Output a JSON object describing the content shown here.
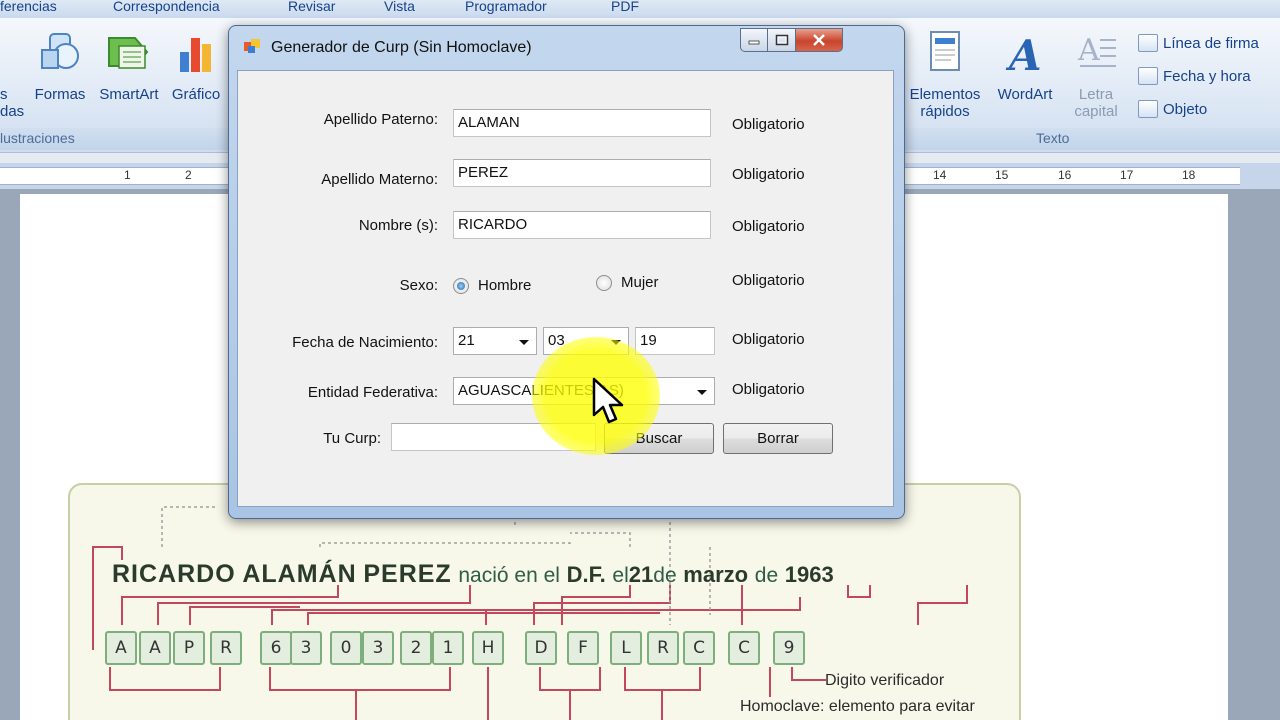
{
  "word": {
    "menu": [
      "ferencias",
      "Correspondencia",
      "Revisar",
      "Vista",
      "Programador",
      "PDF"
    ],
    "ribbon_buttons": {
      "formas": "Formas",
      "smartart": "SmartArt",
      "grafico": "Gráfico",
      "left_cut_1": "s",
      "left_cut_2": "das",
      "elementos_1": "Elementos",
      "elementos_2": "rápidos",
      "wordart": "WordArt",
      "letra_1": "Letra",
      "letra_2": "capital"
    },
    "small_buttons": [
      "Línea de firma",
      "Fecha y hora",
      "Objeto"
    ],
    "group_labels": {
      "ilustraciones": "lustraciones",
      "texto": "Texto"
    },
    "ruler_left": [
      "1",
      "2"
    ],
    "ruler_right": [
      "14",
      "15",
      "16",
      "17",
      "18"
    ]
  },
  "dialog": {
    "title": "Generador de Curp (Sin Homoclave)",
    "labels": {
      "apellido_paterno": "Apellido Paterno:",
      "apellido_materno": "Apellido Materno:",
      "nombre": "Nombre (s):",
      "sexo": "Sexo:",
      "fecha": "Fecha de Nacimiento:",
      "entidad": "Entidad Federativa:",
      "curp": "Tu Curp:"
    },
    "values": {
      "apellido_paterno": "ALAMAN",
      "apellido_materno": "PEREZ",
      "nombre": "RICARDO",
      "dia": "21",
      "mes": "03",
      "anio": "19",
      "entidad": "AGUASCALIENTES(AS)",
      "curp": ""
    },
    "sexo_options": {
      "hombre": "Hombre",
      "mujer": "Mujer"
    },
    "sexo_selected": "Hombre",
    "obligatorio": "Obligatorio",
    "buttons": {
      "buscar": "Buscar",
      "borrar": "Borrar"
    }
  },
  "figure": {
    "name_part1": "RICARDO",
    "name_part2": "ALAMÁN",
    "name_part3": "PEREZ",
    "w_nacio": "nació en el",
    "w_df": "D.F.",
    "w_el": "el",
    "w_21": "21",
    "w_de1": "de",
    "w_marzo": "marzo",
    "w_de2": "de",
    "w_1963": "1963",
    "boxes": [
      "A",
      "A",
      "P",
      "R",
      "6",
      "3",
      "0",
      "3",
      "2",
      "1",
      "H",
      "D",
      "F",
      "L",
      "R",
      "C",
      "C",
      "9"
    ],
    "note_digito": "Digito verificador",
    "note_homoclave": "Homoclave: elemento para evitar"
  },
  "colors": {
    "accent_blue": "#15428b",
    "highlight": "#ffff00",
    "close_red": "#c8452b"
  }
}
